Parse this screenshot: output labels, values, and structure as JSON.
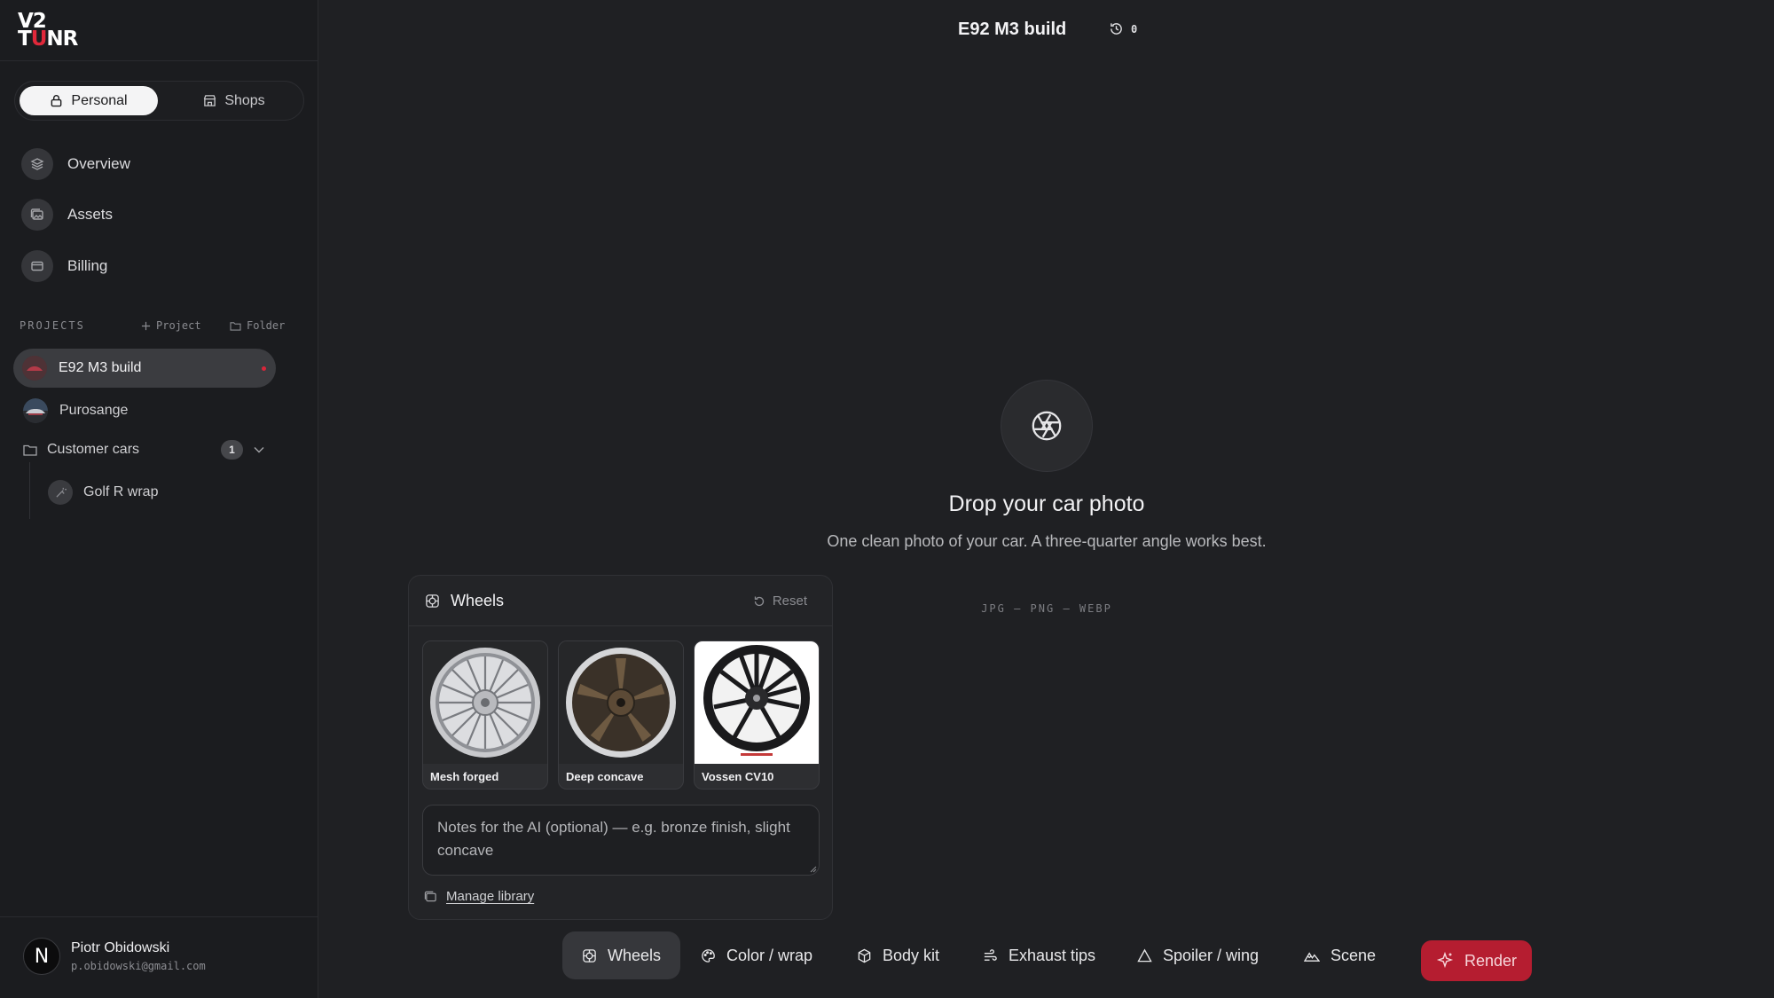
{
  "app": {
    "logo_line1": "V2",
    "logo_line2_a": "T",
    "logo_line2_b": "U",
    "logo_line2_c": "NR"
  },
  "workspace_switch": {
    "personal": "Personal",
    "shops": "Shops",
    "selected": "Personal"
  },
  "nav": {
    "overview": "Overview",
    "assets": "Assets",
    "billing": "Billing"
  },
  "projects": {
    "header": "PROJECTS",
    "add_project": "Project",
    "add_folder": "Folder",
    "active": "E92 M3 build",
    "item_2": "Purosange",
    "folder": "Customer cars",
    "folder_count": "1",
    "folder_child": "Golf R wrap"
  },
  "user": {
    "initial": "N",
    "name": "Piotr Obidowski",
    "email": "p.obidowski@gmail.com"
  },
  "topbar": {
    "title": "E92 M3 build",
    "history_count": "0"
  },
  "dropzone": {
    "title": "Drop your car photo",
    "subtitle": "One clean photo of your car. A three-quarter angle works best.",
    "formats": "JPG — PNG — WEBP"
  },
  "wheels_panel": {
    "title": "Wheels",
    "reset": "Reset",
    "options": [
      {
        "label": "Mesh forged"
      },
      {
        "label": "Deep concave"
      },
      {
        "label": "Vossen CV10"
      }
    ],
    "notes_placeholder": "Notes for the AI (optional) — e.g. bronze finish, slight concave",
    "manage_library": "Manage library"
  },
  "toolbar": {
    "wheels": "Wheels",
    "color_wrap": "Color / wrap",
    "body_kit": "Body kit",
    "exhaust_tips": "Exhaust tips",
    "spoiler_wing": "Spoiler / wing",
    "scene": "Scene",
    "render": "Render",
    "active": "Wheels"
  },
  "colors": {
    "background": "#1f2023",
    "sidebar": "#1b1c1f",
    "accent": "#b51d30",
    "brand_red": "#e0283a"
  }
}
